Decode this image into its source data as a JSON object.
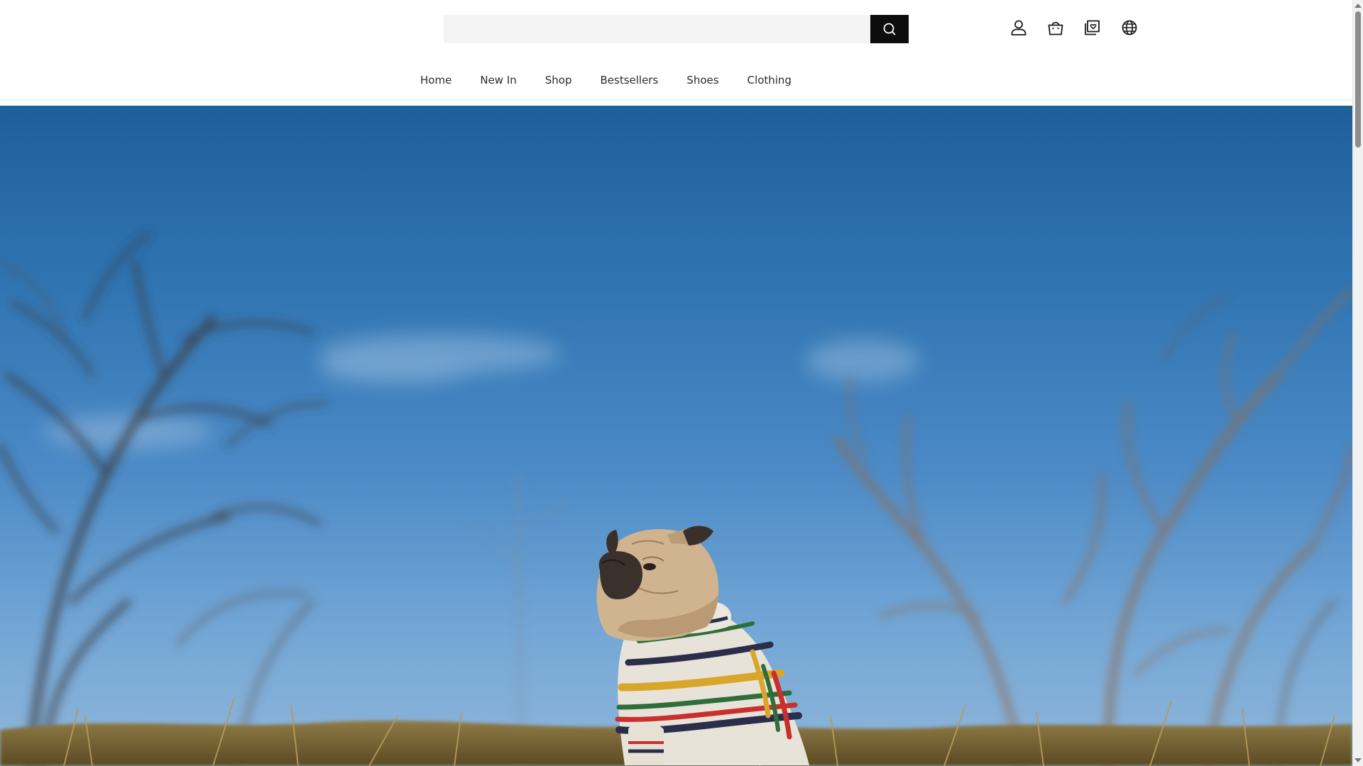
{
  "search": {
    "placeholder": "",
    "value": "",
    "button_icon": "search-icon"
  },
  "header_icons": [
    {
      "name": "account-icon"
    },
    {
      "name": "shopping-bag-icon"
    },
    {
      "name": "wishlist-icon"
    },
    {
      "name": "globe-icon"
    }
  ],
  "nav": {
    "items": [
      "Home",
      "New In",
      "Shop",
      "Bestsellers",
      "Shoes",
      "Clothing"
    ]
  },
  "hero": {
    "image": "pug-in-striped-sweater-on-hill-photo"
  },
  "colors": {
    "search_button": "#0d0d0d",
    "search_field": "#f4f4f4",
    "sky": "#2e73b0"
  }
}
